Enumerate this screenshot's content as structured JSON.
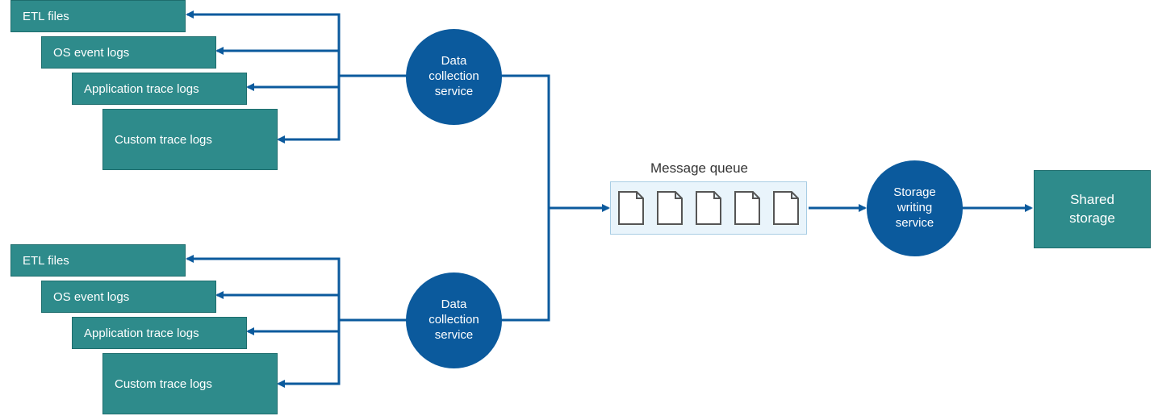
{
  "colors": {
    "teal": "#2E8B8B",
    "blue": "#0B5A9D",
    "connector": "#0B5A9D",
    "queueFill": "#e9f4fb",
    "queueBorder": "#a8cde4",
    "docStroke": "#555555"
  },
  "sourceGroups": [
    {
      "id": "group-top",
      "sources": [
        {
          "id": "etl",
          "label": "ETL files"
        },
        {
          "id": "os-event",
          "label": "OS event logs"
        },
        {
          "id": "app-trace",
          "label": "Application trace logs"
        },
        {
          "id": "custom-trace",
          "label": "Custom trace logs"
        }
      ]
    },
    {
      "id": "group-bottom",
      "sources": [
        {
          "id": "etl",
          "label": "ETL files"
        },
        {
          "id": "os-event",
          "label": "OS event logs"
        },
        {
          "id": "app-trace",
          "label": "Application trace logs"
        },
        {
          "id": "custom-trace",
          "label": "Custom trace logs"
        }
      ]
    }
  ],
  "collectors": [
    {
      "id": "collector-top",
      "label": "Data\ncollection\nservice"
    },
    {
      "id": "collector-bottom",
      "label": "Data\ncollection\nservice"
    }
  ],
  "queue": {
    "label": "Message queue",
    "messageCount": 5
  },
  "writer": {
    "label": "Storage\nwriting\nservice"
  },
  "storage": {
    "label": "Shared\nstorage"
  }
}
